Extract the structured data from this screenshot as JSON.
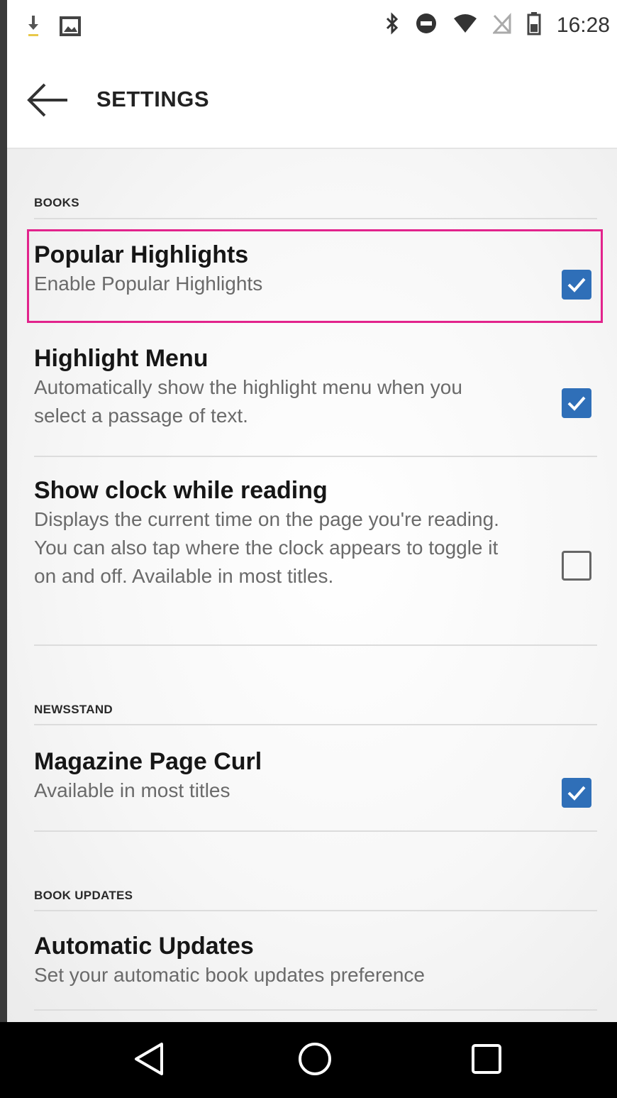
{
  "status_bar": {
    "time": "16:28",
    "left_icons": [
      "download-icon",
      "image-icon"
    ],
    "right_icons": [
      "bluetooth-icon",
      "do-not-disturb-icon",
      "wifi-icon",
      "no-sim-icon",
      "battery-icon"
    ]
  },
  "app_bar": {
    "title": "SETTINGS",
    "back_icon": "arrow-left-icon"
  },
  "sections": {
    "books": {
      "header": "BOOKS",
      "items": [
        {
          "title": "Popular Highlights",
          "description": "Enable Popular Highlights",
          "checked": true,
          "highlighted": true
        },
        {
          "title": "Highlight Menu",
          "description": "Automatically show the highlight menu when you select a passage of text.",
          "checked": true
        },
        {
          "title": "Show clock while reading",
          "description": "Displays the current time on the page you're reading. You can also tap where the clock appears to toggle it on and off. Available in most titles.",
          "checked": false
        }
      ]
    },
    "newsstand": {
      "header": "NEWSSTAND",
      "items": [
        {
          "title": "Magazine Page Curl",
          "description": "Available in most titles",
          "checked": true
        }
      ]
    },
    "book_updates": {
      "header": "BOOK UPDATES",
      "items": [
        {
          "title": "Automatic Updates",
          "description": "Set your automatic book updates preference"
        }
      ]
    }
  },
  "nav_bar": {
    "icons": [
      "back-triangle-icon",
      "home-circle-icon",
      "recents-square-icon"
    ]
  },
  "colors": {
    "checkbox_checked": "#2f6fb8",
    "highlight_border": "#e2238c",
    "nav_background": "#000000"
  }
}
